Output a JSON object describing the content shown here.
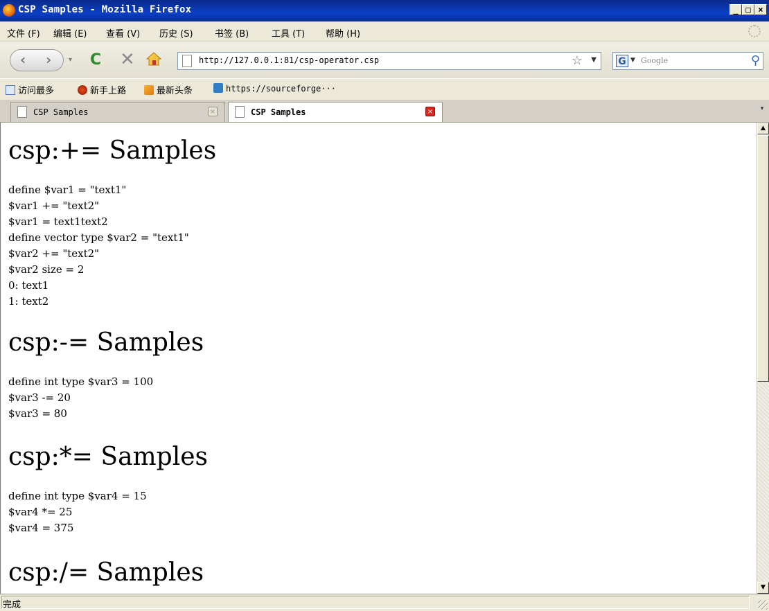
{
  "window": {
    "title": "CSP Samples - Mozilla Firefox",
    "min_btn": "_",
    "max_btn": "□",
    "close_btn": "×"
  },
  "menu": {
    "items": [
      "文件 (F)",
      "编辑 (E)",
      "查看 (V)",
      "历史 (S)",
      "书签 (B)",
      "工具 (T)",
      "帮助 (H)"
    ]
  },
  "nav": {
    "url": "http://127.0.0.1:81/csp-operator.csp",
    "search_placeholder": "Google",
    "search_engine_letter": "G"
  },
  "bookmarks": {
    "items": [
      "访问最多",
      "新手上路",
      "最新头条",
      "https://sourceforge···"
    ]
  },
  "tabs": [
    {
      "label": "CSP Samples",
      "active": false
    },
    {
      "label": "CSP Samples",
      "active": true
    }
  ],
  "content": {
    "sections": [
      {
        "heading": "csp:+= Samples",
        "lines": [
          "define $var1 = \"text1\"",
          "$var1 += \"text2\"",
          "$var1 = text1text2",
          "define vector type $var2 = \"text1\"",
          "$var2 += \"text2\"",
          "$var2 size = 2",
          "0: text1",
          "1: text2"
        ]
      },
      {
        "heading": "csp:-= Samples",
        "lines": [
          "define int type $var3 = 100",
          "$var3 -= 20",
          "$var3 = 80"
        ]
      },
      {
        "heading": "csp:*= Samples",
        "lines": [
          "define int type $var4 = 15",
          "$var4 *= 25",
          "$var4 = 375"
        ]
      },
      {
        "heading": "csp:/= Samples",
        "lines": []
      }
    ]
  },
  "status": {
    "text": "完成"
  },
  "colors": {
    "titlebar": "#0b3fc4",
    "chrome": "#ece9d8",
    "tab_close_active": "#d9261c"
  }
}
